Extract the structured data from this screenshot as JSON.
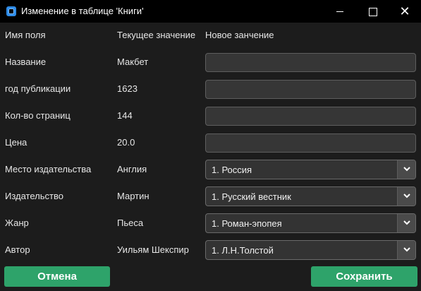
{
  "window": {
    "title": "Изменение в таблице 'Книги'",
    "close_glyph": "✕"
  },
  "header": {
    "field_name": "Имя поля",
    "current_value": "Текущее значение",
    "new_value": "Новое занчение"
  },
  "rows": [
    {
      "label": "Название",
      "current": "Макбет",
      "type": "input",
      "value": ""
    },
    {
      "label": "год публикации",
      "current": "1623",
      "type": "input",
      "value": ""
    },
    {
      "label": "Кол-во страниц",
      "current": "144",
      "type": "input",
      "value": ""
    },
    {
      "label": "Цена",
      "current": "20.0",
      "type": "input",
      "value": ""
    },
    {
      "label": "Место издательства",
      "current": "Англия",
      "type": "select",
      "value": "1. Россия"
    },
    {
      "label": "Издательство",
      "current": "Мартин",
      "type": "select",
      "value": "1. Русский вестник"
    },
    {
      "label": "Жанр",
      "current": "Пьеса",
      "type": "select",
      "value": "1. Роман-эпопея"
    },
    {
      "label": "Автор",
      "current": "Уильям Шекспир",
      "type": "select",
      "value": "1. Л.Н.Толстой"
    }
  ],
  "buttons": {
    "cancel": "Отмена",
    "save": "Сохранить"
  },
  "colors": {
    "accent": "#2ea36a",
    "background": "#1c1c1c",
    "titlebar": "#000000",
    "app_icon": "#2f8ce8"
  },
  "icons": {
    "app": "app-icon",
    "dropdown": "chevron-down-icon"
  }
}
